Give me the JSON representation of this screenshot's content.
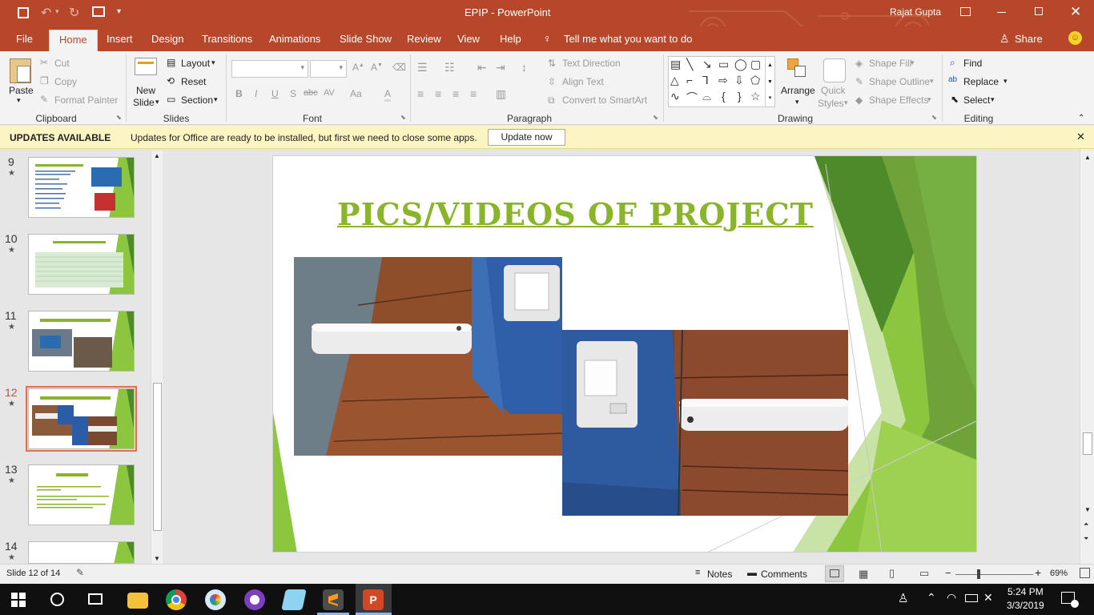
{
  "window": {
    "doc_title": "EPIP",
    "app_name": "PowerPoint",
    "separator": "-",
    "user": "Rajat Gupta"
  },
  "menu": {
    "tabs": [
      "File",
      "Home",
      "Insert",
      "Design",
      "Transitions",
      "Animations",
      "Slide Show",
      "Review",
      "View",
      "Help"
    ],
    "active_tab": "Home",
    "tell_me": "Tell me what you want to do",
    "share": "Share"
  },
  "ribbon": {
    "clipboard": {
      "paste": "Paste",
      "cut": "Cut",
      "copy": "Copy",
      "format_painter": "Format Painter",
      "label": "Clipboard"
    },
    "slides": {
      "new_slide_1": "New",
      "new_slide_2": "Slide",
      "layout": "Layout",
      "reset": "Reset",
      "section": "Section",
      "label": "Slides"
    },
    "font": {
      "label": "Font",
      "bold": "B",
      "italic": "I",
      "underline": "U",
      "shadow": "S",
      "strike": "abc",
      "spacing": "AV",
      "case": "Aa",
      "color": "A"
    },
    "paragraph": {
      "text_direction": "Text Direction",
      "align_text": "Align Text",
      "convert_smartart": "Convert to SmartArt",
      "label": "Paragraph"
    },
    "drawing": {
      "arrange": "Arrange",
      "quick_styles_1": "Quick",
      "quick_styles_2": "Styles",
      "shape_fill": "Shape Fill",
      "shape_outline": "Shape Outline",
      "shape_effects": "Shape Effects",
      "label": "Drawing"
    },
    "editing": {
      "find": "Find",
      "replace": "Replace",
      "select": "Select",
      "label": "Editing"
    }
  },
  "update_bar": {
    "title": "UPDATES AVAILABLE",
    "message": "Updates for Office are ready to be installed, but first we need to close some apps.",
    "button": "Update now"
  },
  "thumbnails": [
    {
      "number": "9",
      "title": ""
    },
    {
      "number": "10",
      "title": ""
    },
    {
      "number": "11",
      "title": ""
    },
    {
      "number": "12",
      "title": ""
    },
    {
      "number": "13",
      "title": ""
    },
    {
      "number": "14",
      "title": ""
    }
  ],
  "selected_slide": "12",
  "slide": {
    "title": "PICS/VIDEOS OF PROJECT"
  },
  "status": {
    "slide_info": "Slide 12 of 14",
    "notes": "Notes",
    "comments": "Comments",
    "zoom": "69%"
  },
  "taskbar": {
    "time": "5:24 PM",
    "date": "3/3/2019"
  },
  "colors": {
    "accent": "#b7472a",
    "slide_green": "#8cc63f",
    "title_green": "#8ab52a"
  }
}
